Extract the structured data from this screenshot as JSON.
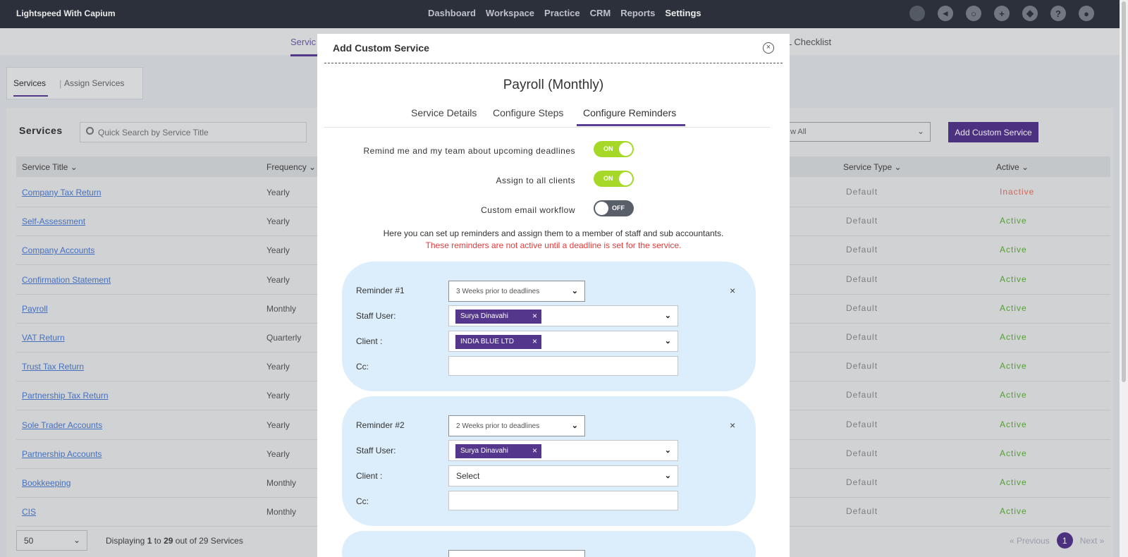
{
  "topnav": {
    "brand": "Lightspeed With Capium",
    "menu": [
      "Dashboard",
      "Workspace",
      "Practice",
      "CRM",
      "Reports",
      "Settings"
    ],
    "icons": [
      "circle-icon",
      "megaphone-icon",
      "search-icon",
      "plus-icon",
      "ticket-icon",
      "help-icon",
      "user-icon"
    ]
  },
  "subnav": {
    "left": "Servic",
    "right": "L Checklist"
  },
  "tabs": {
    "services": "Services",
    "assign": "Assign Services"
  },
  "panel": {
    "title": "Services",
    "search_placeholder": "Quick Search by Service Title",
    "filter_value": "w All",
    "add_button": "Add Custom Service"
  },
  "table": {
    "headers": [
      "Service Title",
      "Frequency",
      "Service Type",
      "Active"
    ],
    "rows": [
      {
        "title": "Company Tax Return",
        "frequency": "Yearly",
        "type": "Default",
        "active": "Inactive"
      },
      {
        "title": "Self-Assessment",
        "frequency": "Yearly",
        "type": "Default",
        "active": "Active"
      },
      {
        "title": "Company Accounts",
        "frequency": "Yearly",
        "type": "Default",
        "active": "Active"
      },
      {
        "title": "Confirmation Statement",
        "frequency": "Yearly",
        "type": "Default",
        "active": "Active"
      },
      {
        "title": "Payroll",
        "frequency": "Monthly",
        "type": "Default",
        "active": "Active"
      },
      {
        "title": "VAT Return",
        "frequency": "Quarterly",
        "type": "Default",
        "active": "Active"
      },
      {
        "title": "Trust Tax Return",
        "frequency": "Yearly",
        "type": "Default",
        "active": "Active"
      },
      {
        "title": "Partnership Tax Return",
        "frequency": "Yearly",
        "type": "Default",
        "active": "Active"
      },
      {
        "title": "Sole Trader Accounts",
        "frequency": "Yearly",
        "type": "Default",
        "active": "Active"
      },
      {
        "title": "Partnership Accounts",
        "frequency": "Yearly",
        "type": "Default",
        "active": "Active"
      },
      {
        "title": "Bookkeeping",
        "frequency": "Monthly",
        "type": "Default",
        "active": "Active"
      },
      {
        "title": "CIS",
        "frequency": "Monthly",
        "type": "Default",
        "active": "Active"
      }
    ]
  },
  "footer": {
    "page_size": "50",
    "display_prefix": "Displaying ",
    "from": "1",
    "to_word": " to ",
    "to": "29",
    "suffix": " out of 29 Services",
    "prev": "« Previous",
    "page": "1",
    "next": "Next »"
  },
  "modal": {
    "title": "Add Custom Service",
    "service_name": "Payroll (Monthly)",
    "tabs": [
      "Service Details",
      "Configure Steps",
      "Configure Reminders"
    ],
    "toggles": [
      {
        "label": "Remind me and my team about upcoming deadlines",
        "state": "ON"
      },
      {
        "label": "Assign to all clients",
        "state": "ON"
      },
      {
        "label": "Custom email workflow",
        "state": "OFF"
      }
    ],
    "info": "Here you can set up reminders and assign them to a member of staff and sub accountants.",
    "warning": "These reminders are not active until a deadline is set for the service.",
    "reminders": [
      {
        "label": "Reminder #1",
        "timing": "3 Weeks prior to deadlines",
        "staff_label": "Staff User:",
        "staff": "Surya Dinavahi",
        "client_label": "Client :",
        "client": "INDIA BLUE LTD",
        "cc_label": "Cc:"
      },
      {
        "label": "Reminder #2",
        "timing": "2 Weeks prior to deadlines",
        "staff_label": "Staff User:",
        "staff": "Surya Dinavahi",
        "client_label": "Client :",
        "client_placeholder": "Select",
        "cc_label": "Cc:"
      }
    ]
  },
  "colors": {
    "brand_purple": "#54368d",
    "toggle_on": "#a6d927",
    "active_green": "#5cae3a",
    "inactive_red": "#e07060",
    "warning_red": "#e23a3a"
  }
}
